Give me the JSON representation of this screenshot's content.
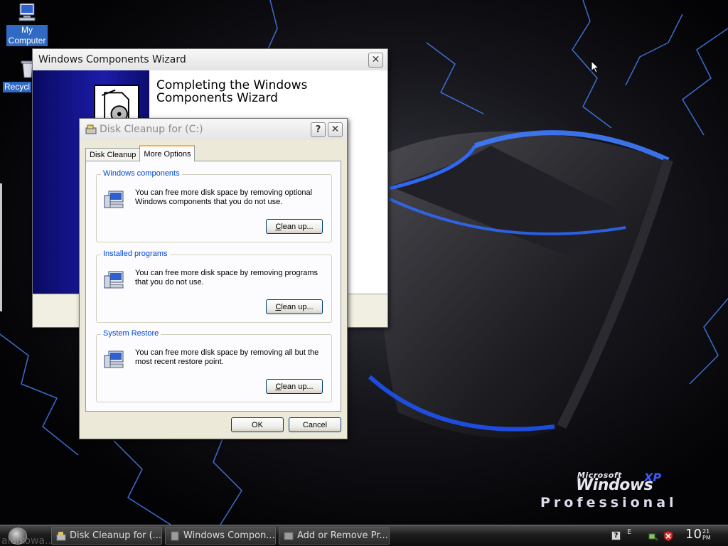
{
  "desktop": {
    "icons": [
      {
        "label_line1": "My",
        "label_line2": "Computer"
      },
      {
        "label": "Recycl"
      }
    ],
    "brand": {
      "microsoft": "Microsoft",
      "windows": "Windows",
      "xp": "XP",
      "edition": "Professional"
    }
  },
  "wizard": {
    "title": "Windows Components Wizard",
    "heading_line1": "Completing the Windows",
    "heading_line2": "Components Wizard"
  },
  "cleanup": {
    "title": "Disk Cleanup for  (C:)",
    "tabs": [
      {
        "label": "Disk Cleanup"
      },
      {
        "label": "More Options"
      }
    ],
    "groups": [
      {
        "title": "Windows components",
        "text": "You can free more disk space by removing optional Windows components that you do not use.",
        "button_mnemonic": "C",
        "button_rest": "lean up..."
      },
      {
        "title": "Installed programs",
        "text": "You can free more disk space by removing programs that you do not use.",
        "button_mnemonic": "C",
        "button_rest": "lean up..."
      },
      {
        "title": "System Restore",
        "text": "You can free more disk space by removing all but the most recent restore point.",
        "button_mnemonic": "C",
        "button_rest": "lean up..."
      }
    ],
    "ok_label": "OK",
    "cancel_label": "Cancel"
  },
  "taskbar": {
    "tasks": [
      {
        "label": "Disk Cleanup for  (..."
      },
      {
        "label": "Windows Compon..."
      },
      {
        "label": "Add or Remove Pr..."
      }
    ],
    "tray": {
      "help": "?",
      "lang": "E"
    },
    "clock": {
      "hour": "10",
      "minute": "21",
      "ampm": "PM"
    },
    "watermark": "alaikowa..."
  },
  "colors": {
    "group_title": "#0046d5",
    "desktop_selection": "#316ac5",
    "glow": "#2f6bff"
  }
}
